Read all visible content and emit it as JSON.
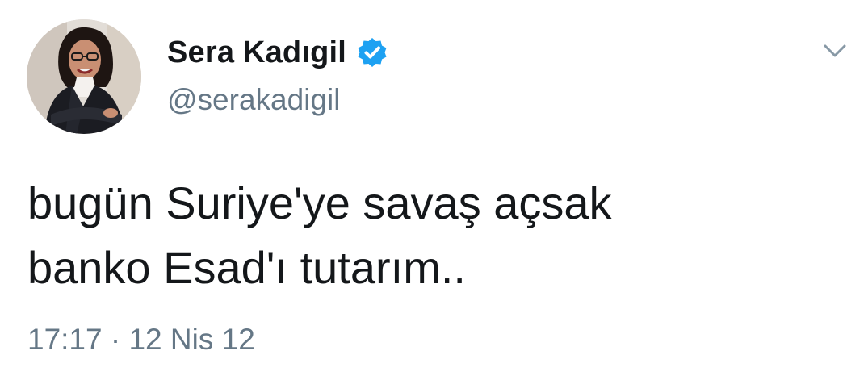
{
  "author": {
    "display_name": "Sera Kadıgil",
    "handle": "@serakadigil",
    "verified_icon": "verified-badge-icon",
    "avatar_icon": "profile-photo"
  },
  "menu": {
    "icon": "chevron-down-icon"
  },
  "tweet": {
    "lines": [
      "bugün Suriye'ye savaş açsak",
      "banko Esad'ı tutarım.."
    ],
    "time": "17:17",
    "separator": "·",
    "date": "12 Nis 12"
  },
  "colors": {
    "verified_blue": "#1da1f2",
    "secondary_text": "#657786",
    "primary_text": "#14171a"
  }
}
